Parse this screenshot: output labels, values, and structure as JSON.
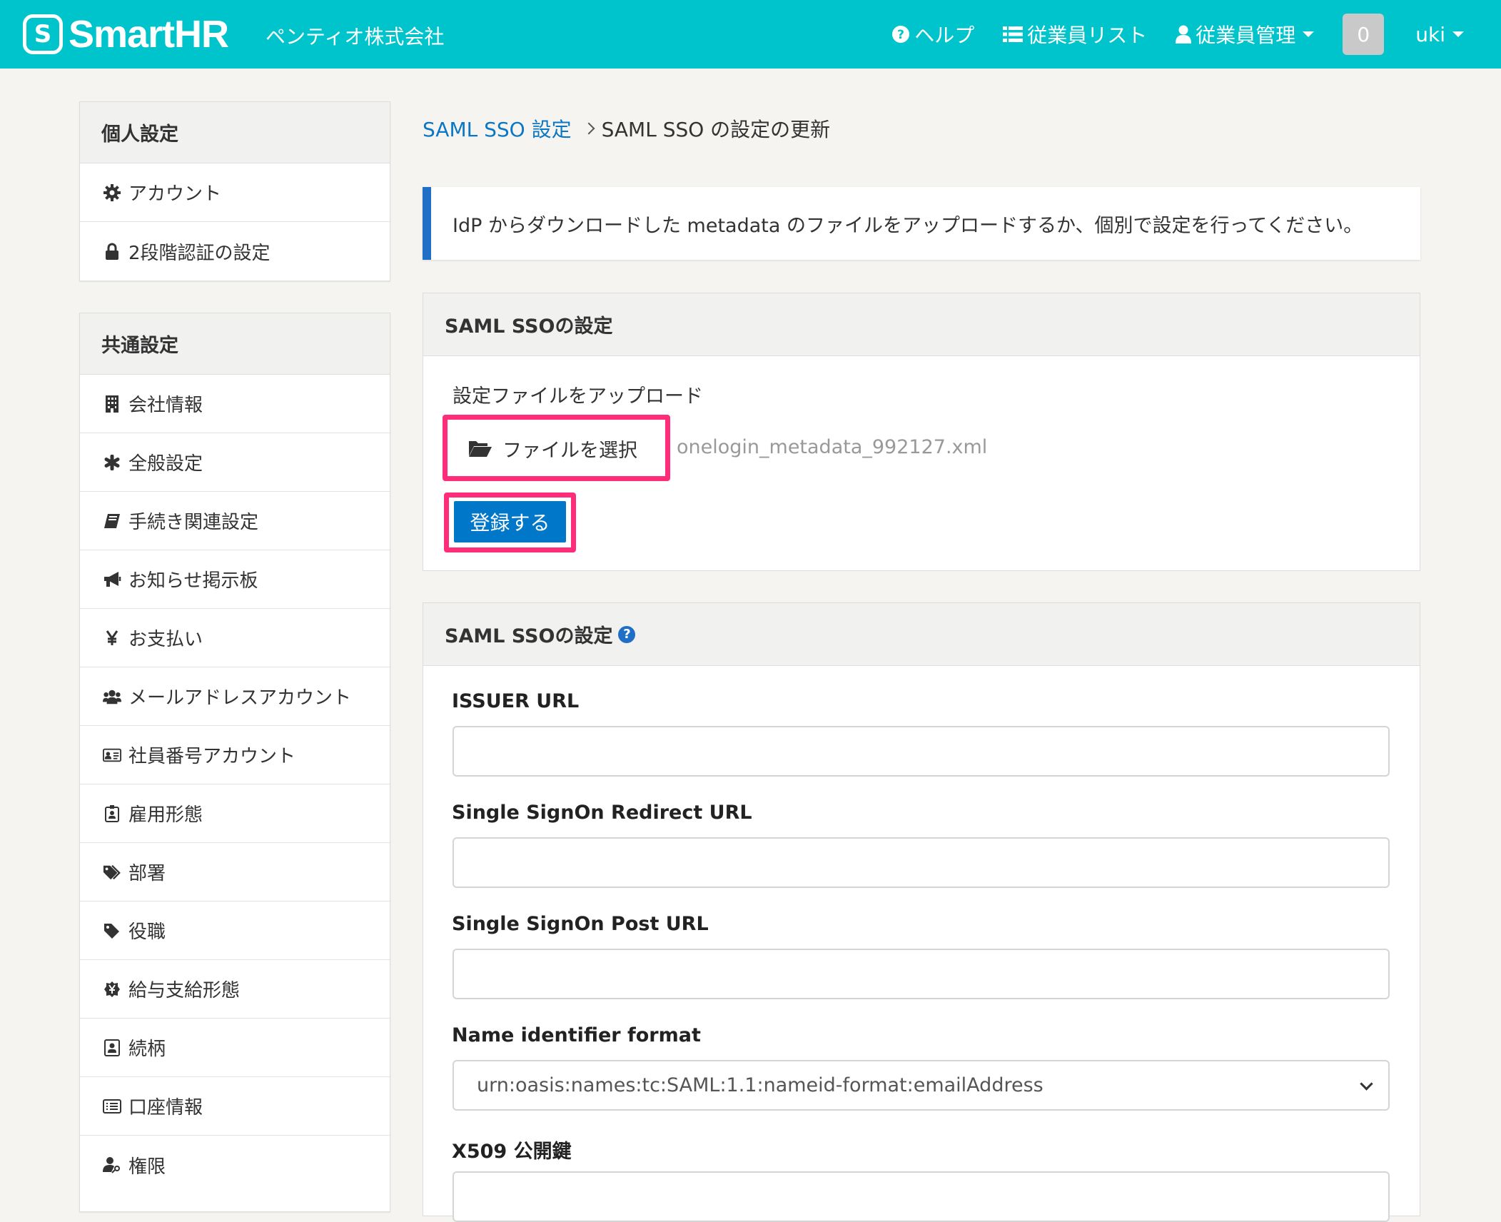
{
  "header": {
    "logo_mark": "S",
    "logo_text": "SmartHR",
    "company": "ペンティオ株式会社",
    "nav": {
      "help": "ヘルプ",
      "employee_list": "従業員リスト",
      "employee_manage": "従業員管理",
      "notification_count": "0",
      "user": "uki"
    }
  },
  "sidebar": {
    "personal": {
      "title": "個人設定",
      "items": [
        {
          "label": "アカウント",
          "icon": "gear-icon"
        },
        {
          "label": "2段階認証の設定",
          "icon": "lock-icon"
        }
      ]
    },
    "common": {
      "title": "共通設定",
      "items": [
        {
          "label": "会社情報",
          "icon": "building-icon"
        },
        {
          "label": "全般設定",
          "icon": "asterisk-icon"
        },
        {
          "label": "手続き関連設定",
          "icon": "book-icon"
        },
        {
          "label": "お知らせ掲示板",
          "icon": "bullhorn-icon"
        },
        {
          "label": "お支払い",
          "icon": "yen-icon"
        },
        {
          "label": "メールアドレスアカウント",
          "icon": "users-icon"
        },
        {
          "label": "社員番号アカウント",
          "icon": "id-card-icon"
        },
        {
          "label": "雇用形態",
          "icon": "badge-icon"
        },
        {
          "label": "部署",
          "icon": "tags-icon"
        },
        {
          "label": "役職",
          "icon": "tag-icon"
        },
        {
          "label": "給与支給形態",
          "icon": "yen-circle-icon"
        },
        {
          "label": "続柄",
          "icon": "portrait-icon"
        },
        {
          "label": "口座情報",
          "icon": "list-alt-icon"
        },
        {
          "label": "権限",
          "icon": "user-key-icon"
        }
      ]
    }
  },
  "breadcrumb": {
    "link": "SAML SSO 設定",
    "current": "SAML SSO の設定の更新"
  },
  "notice": "IdP からダウンロードした metadata のファイルをアップロードするか、個別で設定を行ってください。",
  "upload_card": {
    "title": "SAML SSOの設定",
    "upload_label": "設定ファイルをアップロード",
    "choose_file_label": "ファイルを選択",
    "file_name": "onelogin_metadata_992127.xml",
    "submit_label": "登録する"
  },
  "settings_card": {
    "title": "SAML SSOの設定",
    "help_icon": "question-circle-icon",
    "fields": {
      "issuer_url": {
        "label": "ISSUER URL",
        "value": ""
      },
      "sso_redirect_url": {
        "label": "Single SignOn Redirect URL",
        "value": ""
      },
      "sso_post_url": {
        "label": "Single SignOn Post URL",
        "value": ""
      },
      "name_id_format": {
        "label": "Name identifier format",
        "value": "urn:oasis:names:tc:SAML:1.1:nameid-format:emailAddress"
      },
      "x509": {
        "label": "X509 公開鍵",
        "value": ""
      }
    }
  },
  "colors": {
    "header_bg": "#00c4cc",
    "link": "#0b77c4",
    "primary_button": "#0077c8",
    "highlight": "#ff2c7a",
    "notice_bar": "#1f6fc6"
  }
}
